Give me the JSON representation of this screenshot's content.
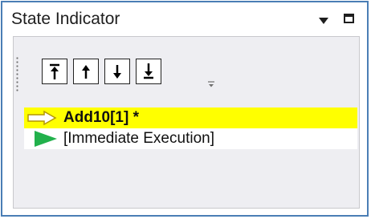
{
  "window": {
    "title": "State Indicator",
    "menu_icon": "chevron-down-icon",
    "maximize_icon": "maximize-icon"
  },
  "toolbar": {
    "buttons": [
      {
        "name": "move-to-top-button",
        "icon": "arrow-up-to-bar-icon"
      },
      {
        "name": "move-up-button",
        "icon": "arrow-up-icon"
      },
      {
        "name": "move-down-button",
        "icon": "arrow-down-icon"
      },
      {
        "name": "move-to-bottom-button",
        "icon": "arrow-down-to-bar-icon"
      }
    ],
    "overflow_icon": "toolbar-overflow-icon"
  },
  "stack": [
    {
      "label": "Add10[1] *",
      "icon": "current-line-arrow-icon",
      "highlight": "#ffff00",
      "bold": true
    },
    {
      "label": "[Immediate Execution]",
      "icon": "green-triangle-icon",
      "highlight": "#ffffff",
      "bold": false
    }
  ],
  "colors": {
    "border": "#4a7eb5",
    "highlight": "#ffff00",
    "execution_green": "#22b14c",
    "panel_bg": "#eeeef2"
  }
}
